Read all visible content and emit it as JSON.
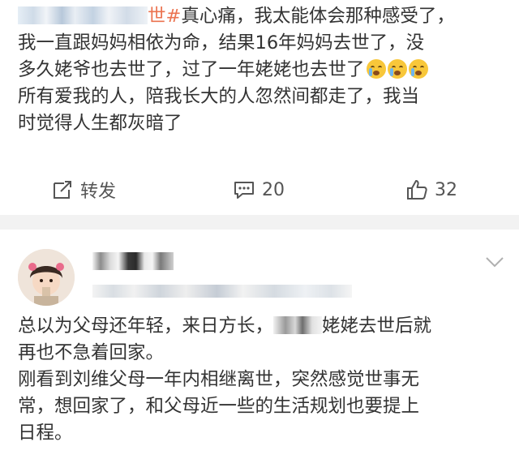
{
  "post1": {
    "topic": "世#",
    "line1_rest": "真心痛，我太能体会那种感受了，",
    "line2": "我一直跟妈妈相依为命，结果16年妈妈去世了，没",
    "line3": "多久姥爷也去世了，过了一年姥姥也去世了",
    "line4": "所有爱我的人，陪我长大的人忽然间都走了，我当",
    "line5": "时觉得人生都灰暗了",
    "emojis": [
      "crying-face",
      "crying-face",
      "crying-face"
    ]
  },
  "actions": {
    "repost_label": "转发",
    "comment_count": "20",
    "like_count": "32"
  },
  "post2": {
    "line1_a": "总以为父母还年轻，来日方长，",
    "line1_b": "姥姥去世后就",
    "line2": "再也不急着回家。",
    "line3": "刚看到刘维父母一年内相继离世，突然感觉世事无",
    "line4": "常，想回家了，和父母近一些的生活规划也要提上",
    "line5": "日程。"
  },
  "colors": {
    "topic": "#eb7350",
    "text": "#333333",
    "separator": "#f2f2f2"
  }
}
